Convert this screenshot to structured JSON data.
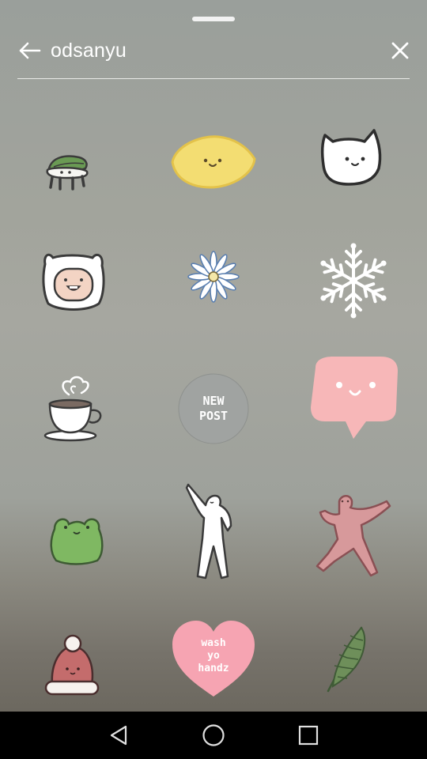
{
  "search": {
    "query": "odsanyu"
  },
  "stickers": {
    "new_post_line1": "NEW",
    "new_post_line2": "POST",
    "heart_line1": "wash",
    "heart_line2": "yo",
    "heart_line3": "handz"
  },
  "colors": {
    "panel_background": "#a3a59e",
    "header_text": "#ffffff",
    "navbar": "#000000"
  },
  "icons": {
    "back": "arrow-left-icon",
    "close": "close-icon",
    "nav_back": "triangle-back-icon",
    "nav_home": "circle-home-icon",
    "nav_recents": "square-recents-icon"
  }
}
